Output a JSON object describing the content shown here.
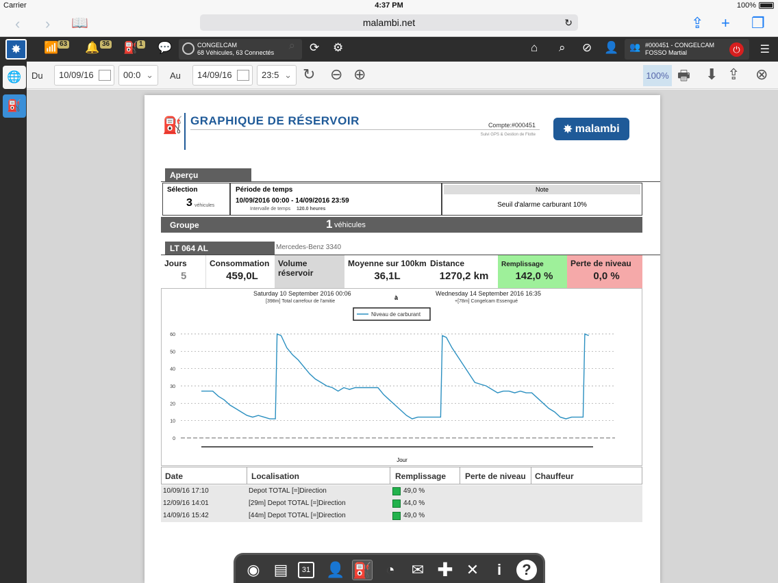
{
  "status_bar": {
    "carrier": "Carrier",
    "time": "4:37 PM",
    "battery": "100%"
  },
  "browser": {
    "url": "malambi.net"
  },
  "toolbar": {
    "wifi_count": "63",
    "alert_count": "36",
    "fuel_alert_count": "1",
    "group_name": "CONGELCAM",
    "group_status": "68 Véhicules, 63 Connectés",
    "account_line1": "#000451  -  CONGELCAM",
    "account_line2": "FOSSO Martial"
  },
  "datebar": {
    "from_label": "Du",
    "from_date": "10/09/16",
    "from_time": "00:0",
    "to_label": "Au",
    "to_date": "14/09/16",
    "to_time": "23:5",
    "zoom": "100%"
  },
  "report": {
    "title": "GRAPHIQUE DE RÉSERVOIR",
    "account": "Compte:#000451",
    "tagline": "Suivi GPS & Gestion de Flotte",
    "logo_text": "malambi",
    "overview_label": "Aperçu",
    "selection_label": "Sélection",
    "selection_value": "3",
    "selection_unit": "véhicules",
    "period_label": "Période de temps",
    "period_value": "10/09/2016 00:00 - 14/09/2016 23:59",
    "interval_label": "Intervalle de temps",
    "interval_value": "120.0 heures",
    "note_label": "Note",
    "note_value": "Seuil d'alarme carburant 10%",
    "group_label": "Groupe",
    "group_value": "1",
    "group_unit": "véhicules",
    "vehicle_plate": "LT 064 AL",
    "vehicle_model": "Mercedes-Benz 3340",
    "stats": {
      "jours_label": "Jours",
      "jours_value": "5",
      "consommation_label": "Consommation",
      "consommation_value": "459,0L",
      "volume_label": "Volume réservoir",
      "moyenne_label": "Moyenne sur 100km",
      "moyenne_value": "36,1L",
      "distance_label": "Distance",
      "distance_value": "1270,2 km",
      "remplissage_label": "Remplissage",
      "remplissage_value": "142,0 %",
      "perte_label": "Perte de niveau",
      "perte_value": "0,0 %"
    },
    "chart_header": {
      "start_date": "Saturday 10 September 2016 00:06",
      "start_loc": "[398m] Total carrefour de l'amitie",
      "sep": "à",
      "end_date": "Wednesday 14 September 2016 16:35",
      "end_loc": "+[78m] Congelcam Essengué"
    },
    "table": {
      "headers": [
        "Date",
        "Localisation",
        "Remplissage",
        "Perte de niveau",
        "Chauffeur"
      ],
      "rows": [
        {
          "date": "10/09/16 17:10",
          "loc": "Depot TOTAL [=]Direction",
          "rempl": "49,0 %"
        },
        {
          "date": "12/09/16 14:01",
          "loc": "[29m] Depot TOTAL [=]Direction",
          "rempl": "44,0 %"
        },
        {
          "date": "14/09/16 15:42",
          "loc": "[44m] Depot TOTAL [=]Direction",
          "rempl": "49,0 %"
        }
      ]
    }
  },
  "chart_data": {
    "type": "line",
    "title": "",
    "xlabel": "Jour",
    "ylabel": "",
    "ylim": [
      0,
      60
    ],
    "yticks": [
      0,
      10,
      20,
      30,
      40,
      50,
      60
    ],
    "grid": true,
    "legend_position": "top-center",
    "series": [
      {
        "name": "Niveau de carburant",
        "color": "#2a8fc0",
        "points": [
          [
            0,
            27
          ],
          [
            2,
            27
          ],
          [
            3,
            24
          ],
          [
            4,
            22
          ],
          [
            5,
            19
          ],
          [
            6,
            17
          ],
          [
            7,
            15
          ],
          [
            8,
            13
          ],
          [
            9,
            12
          ],
          [
            10,
            13
          ],
          [
            11,
            12
          ],
          [
            12,
            11
          ],
          [
            13,
            11
          ],
          [
            13.3,
            60
          ],
          [
            14,
            59
          ],
          [
            15,
            52
          ],
          [
            16,
            48
          ],
          [
            17,
            45
          ],
          [
            18,
            41
          ],
          [
            19,
            37
          ],
          [
            20,
            34
          ],
          [
            21,
            32
          ],
          [
            22,
            30
          ],
          [
            23,
            29
          ],
          [
            24,
            27
          ],
          [
            25,
            29
          ],
          [
            26,
            28
          ],
          [
            27,
            29
          ],
          [
            28,
            29
          ],
          [
            29,
            29
          ],
          [
            30,
            29
          ],
          [
            31,
            29
          ],
          [
            32,
            25
          ],
          [
            33,
            22
          ],
          [
            34,
            19
          ],
          [
            35,
            16
          ],
          [
            36,
            13
          ],
          [
            37,
            11
          ],
          [
            38,
            12
          ],
          [
            39,
            12
          ],
          [
            40,
            12
          ],
          [
            41,
            12
          ],
          [
            42,
            12
          ],
          [
            42.3,
            59
          ],
          [
            43,
            58
          ],
          [
            44,
            52
          ],
          [
            45,
            47
          ],
          [
            46,
            42
          ],
          [
            47,
            37
          ],
          [
            48,
            32
          ],
          [
            49,
            31
          ],
          [
            50,
            30
          ],
          [
            51,
            28
          ],
          [
            52,
            26
          ],
          [
            53,
            27
          ],
          [
            54,
            27
          ],
          [
            55,
            26
          ],
          [
            56,
            27
          ],
          [
            57,
            26
          ],
          [
            58,
            26
          ],
          [
            59,
            23
          ],
          [
            60,
            20
          ],
          [
            61,
            17
          ],
          [
            62,
            15
          ],
          [
            63,
            12
          ],
          [
            64,
            11
          ],
          [
            65,
            12
          ],
          [
            66,
            12
          ],
          [
            67,
            12
          ],
          [
            67.3,
            60
          ],
          [
            68,
            59
          ]
        ]
      }
    ]
  },
  "dock": {
    "items": [
      "dashboard-icon",
      "report-icon",
      "calendar-icon",
      "driver-icon",
      "fuel-icon",
      "gauge-icon",
      "mail-icon",
      "add-icon",
      "tools-icon",
      "info-icon",
      "help-icon"
    ],
    "calendar_day": "31"
  }
}
